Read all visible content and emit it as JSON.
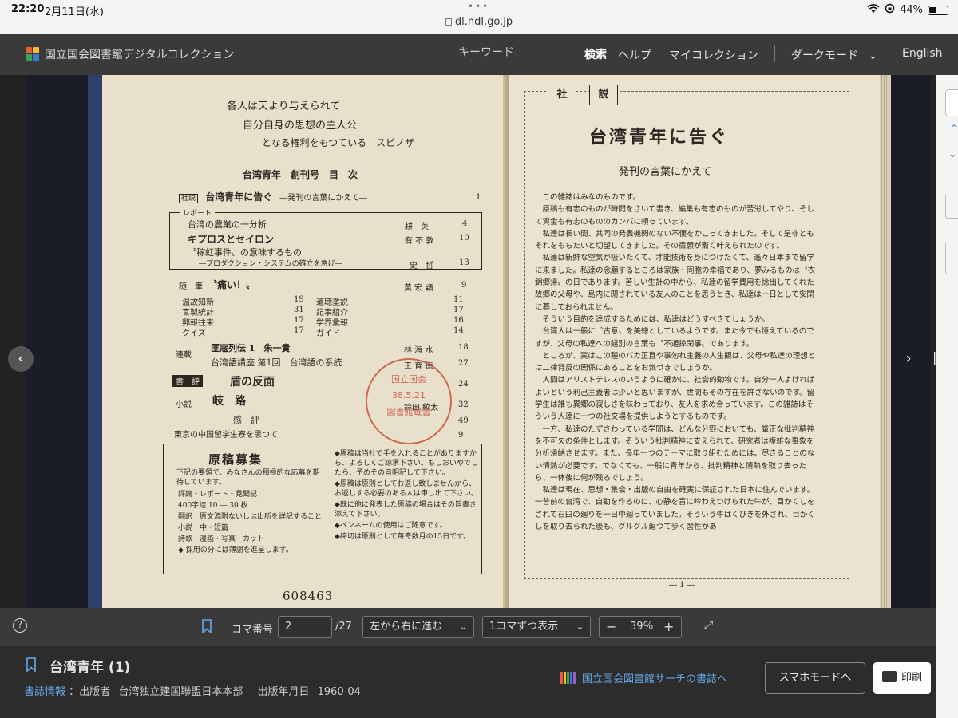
{
  "status_bar": {
    "time": "22:20",
    "date": "2月11日(水)",
    "battery": "44%"
  },
  "url": "dl.ndl.go.jp",
  "header": {
    "logo_text": "国立国会図書館デジタルコレクション",
    "search_placeholder": "キーワード",
    "search_button": "検索",
    "nav": {
      "help": "ヘルプ",
      "my_collection": "マイコレクション",
      "dark_mode": "ダークモード",
      "language": "English"
    }
  },
  "scan": {
    "left_page": {
      "epigraph": [
        "各人は天より与えられて",
        "自分自身の思想の主人公",
        "となる権利をもつている　スピノザ"
      ],
      "toc_heading": "台湾青年　創刊号　目　次",
      "editorial_tag": "社説",
      "editorial_title": "台湾青年に告ぐ",
      "editorial_sub": "―発刊の言葉にかえて―",
      "editorial_page": "1",
      "report_label": "レポート",
      "report_items": [
        {
          "title": "台湾の農業の一分析",
          "author": "耕　英",
          "page": "4"
        },
        {
          "title": "キプロスとセイロン",
          "author": "有 不 敦",
          "page": "10"
        },
        {
          "title": "〝稼虹事件〟の意味するもの",
          "author": "",
          "page": ""
        },
        {
          "title": "―プロダクション・システムの確立を急げ―",
          "author": "史　哲",
          "page": "13"
        }
      ],
      "essay_label": "随　筆",
      "essay_title": "〝痛い！〟",
      "essay_author": "黄 宏 穎",
      "essay_page": "9",
      "misc_items": [
        {
          "title": "温故知新",
          "page": "19"
        },
        {
          "title": "道聴塗説",
          "page": "11"
        },
        {
          "title": "官製統計",
          "page": "31"
        },
        {
          "title": "記事紹介",
          "page": "17"
        },
        {
          "title": "郵報往来",
          "page": "17"
        },
        {
          "title": "学界彙報",
          "page": "16"
        },
        {
          "title": "クイズ",
          "page": "17"
        },
        {
          "title": "ガイド",
          "page": "14"
        }
      ],
      "serial_label": "連載",
      "serial_items": [
        {
          "title": "匪寇列伝 1　朱一貴",
          "author": "林 海 水",
          "page": "18"
        },
        {
          "title": "台湾語講座 第1回　台湾語の系統",
          "author": "王 育 徳",
          "page": "27"
        }
      ],
      "review_label": "書　評",
      "review_title": "盾の反面",
      "review_page": "24",
      "novel_label": "小説",
      "novel_title": "岐　路",
      "novel_author": "鈴田 紋太",
      "novel_page": "32",
      "critique_title": "感　評",
      "critique_page": "49",
      "dorm_title": "東京の中国留学生寮を思つて",
      "dorm_page": "9",
      "stamp_lines": [
        "国立国会",
        "38.5.21",
        "図書館蔵書"
      ],
      "recruit_title": "原稿募集",
      "recruit_intro": "下記の要領で、みなさんの積極的な応募を期待しています。",
      "recruit_left": [
        "評論・レポート・見聞記",
        "400字詰 10 ― 30 枚",
        "翻訳　原文添附ないしは出所を詳記すること",
        "小説　中・短篇",
        "詩歌・漫画・写真・カット",
        "◆ 採用の分には薄謝を進呈します。"
      ],
      "recruit_right": [
        "◆原稿は当社で手を入れることがありますから、よろしくご諒承下さい。もしおいやでしたら、予めその旨明記して下さい。",
        "◆原稿は原則としてお返し致しませんから、お返しする必要のある人は申し出て下さい。",
        "◆既に他に発表した原稿の場合はその旨書き添えて下さい。",
        "◆ペンネームの使用はご随意です。",
        "◆締切は原則として毎奇数月の15日です。"
      ],
      "catalog_number": "608463"
    },
    "right_page": {
      "tag_chars": [
        "社",
        "説"
      ],
      "title": "台湾青年に告ぐ",
      "subtitle": "―発刊の言葉にかえて―",
      "paragraphs": [
        "この雑誌はみなのものです。",
        "原稿も有志のものが時間をさいて書き、編集も有志のものが苦労してやり、そして資金も有志のもののカンパに頼っています。",
        "私達は長い間、共同の発表機関のない不便をかこってきました。そして是非ともそれをもちたいと切望してきました。その宿願が漸く叶えられたのです。",
        "私達は新鮮な空気が吸いたくて、才能技術を身につけたくて、遙々日本まで留学に来ました。私達の念願するところは家族・同胞の幸福であり、夢みるものは〝衣錦郷帰〟の日であります。苦しい生計の中から、私達の留学費用を捻出してくれた故郷の父母や、島内に閉されている友人のことを思うとき、私達は一日として安閑に暮しておられません。",
        "そういう目的を達成するためには、私達はどうすべきでしょうか。",
        "台湾人は一般に〝古意〟を美徳としているようです。また今でも憶えているのですが、父母の私達への餞別の言葉も〝不通掠閑事〟であります。",
        "ところが、実はこの種のバカ正直や事勿れ主義の人生観は、父母や私達の理想とは二律背反の関係にあることをお気づきでしょうか。",
        "人間はアリストテレスのいうように確かに、社会的動物です。自分一人よければよいという利己主義者は少いと思いますが、世間もその存在を許さないのです。留学生は誰も異郷の寂しさを味わっており、友人を求め合っています。この雑誌はそういう人達に一つの社交場を提供しようとするものです。",
        "一方、私達のたずさわっている学問は、どんな分野においても、厳正な批判精神を不可欠の条件とします。そういう批判精神に支えられて、研究者は複雑な事象を分析帰納させます。また、長年一つのテーマに取り組むためには、尽きることのない情熱が必要です。でなくても、一般に青年から、批判精神と情熱を取り去ったら、一体後に何が残るでしょう。",
        "私達は現在、思想・集会・出版の自由を確実に保証された日本に住んでいます。一昔前の台湾で、自動を作るのに、心静を盲に吟わえつけられた牛が、目かくしをされて石臼の廻りを一日中廻っていました。そういう牛はくびきを外され、目かくしを取り去られた後も、グルグル廻つて歩く習性があ"
      ],
      "page_number": "― 1 ―"
    }
  },
  "toolbar": {
    "frame_label": "コマ番号",
    "frame_value": "2",
    "frame_total": "/27",
    "direction": "左から右に進む",
    "display_mode": "1コマずつ表示",
    "zoom": "39％"
  },
  "info": {
    "title": "台湾青年 (1)",
    "bib_link": "書誌情報",
    "publisher_label": "：出版者",
    "publisher": "台湾独立建国聯盟日本本部",
    "date_label": "出版年月日",
    "date": "1960-04",
    "ndl_search_link": "国立国会図書館サーチの書誌へ",
    "smartphone_button": "スマホモードへ",
    "print_button": "印刷"
  },
  "colors": {
    "header_bg": "#3a3a3a",
    "link": "#69a7ea",
    "stamp": "#c8553e",
    "cover": "#2d3f6a",
    "paper": "#e9e0cc"
  }
}
